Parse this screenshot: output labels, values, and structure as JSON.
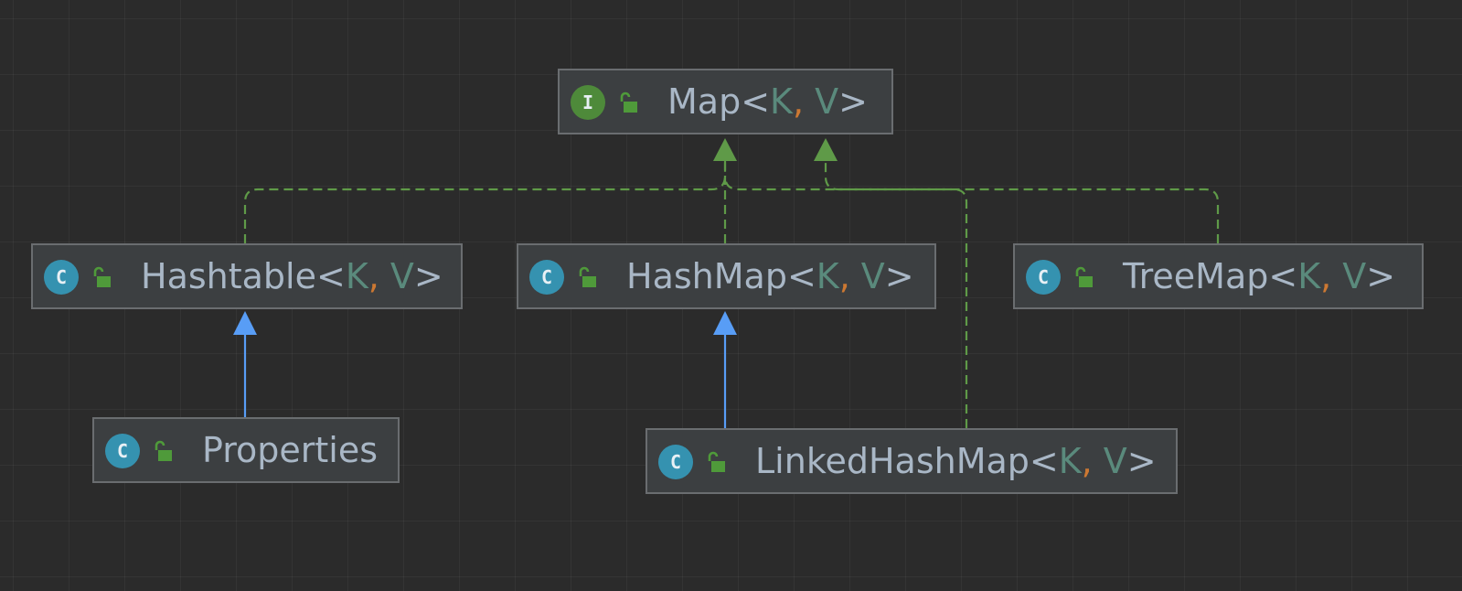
{
  "nodes": {
    "map": {
      "kind": "I",
      "name": "Map",
      "open": "<",
      "p1": "K",
      "comma": ",",
      "p2": "V",
      "close": ">"
    },
    "hashtable": {
      "kind": "C",
      "name": "Hashtable",
      "open": "<",
      "p1": "K",
      "comma": ",",
      "p2": "V",
      "close": ">"
    },
    "hashmap": {
      "kind": "C",
      "name": "HashMap",
      "open": "<",
      "p1": "K",
      "comma": ",",
      "p2": "V",
      "close": ">"
    },
    "treemap": {
      "kind": "C",
      "name": "TreeMap",
      "open": "<",
      "p1": "K",
      "comma": ",",
      "p2": "V",
      "close": ">"
    },
    "properties": {
      "kind": "C",
      "name": "Properties"
    },
    "linkedhashmap": {
      "kind": "C",
      "name": "LinkedHashMap",
      "open": "<",
      "p1": "K",
      "comma": ",",
      "p2": "V",
      "close": ">"
    }
  },
  "edges": [
    {
      "from": "Hashtable",
      "to": "Map",
      "type": "implements"
    },
    {
      "from": "HashMap",
      "to": "Map",
      "type": "implements"
    },
    {
      "from": "TreeMap",
      "to": "Map",
      "type": "implements"
    },
    {
      "from": "LinkedHashMap",
      "to": "Map",
      "type": "implements"
    },
    {
      "from": "Properties",
      "to": "Hashtable",
      "type": "extends"
    },
    {
      "from": "LinkedHashMap",
      "to": "HashMap",
      "type": "extends"
    }
  ],
  "colors": {
    "background": "#2b2b2b",
    "node_fill": "#3c3f41",
    "node_border": "#6a6d70",
    "text": "#a9b7c6",
    "type_param": "#5a8a7c",
    "comma": "#cc7832",
    "implements_edge": "#5f9a48",
    "extends_edge": "#589df6",
    "class_icon": "#3592b0",
    "interface_icon": "#4e8a3a",
    "lock_icon": "#4f9a3a"
  },
  "icons": {
    "class": "class-c-icon",
    "interface": "interface-i-icon",
    "visibility": "public-lock-open-icon"
  }
}
